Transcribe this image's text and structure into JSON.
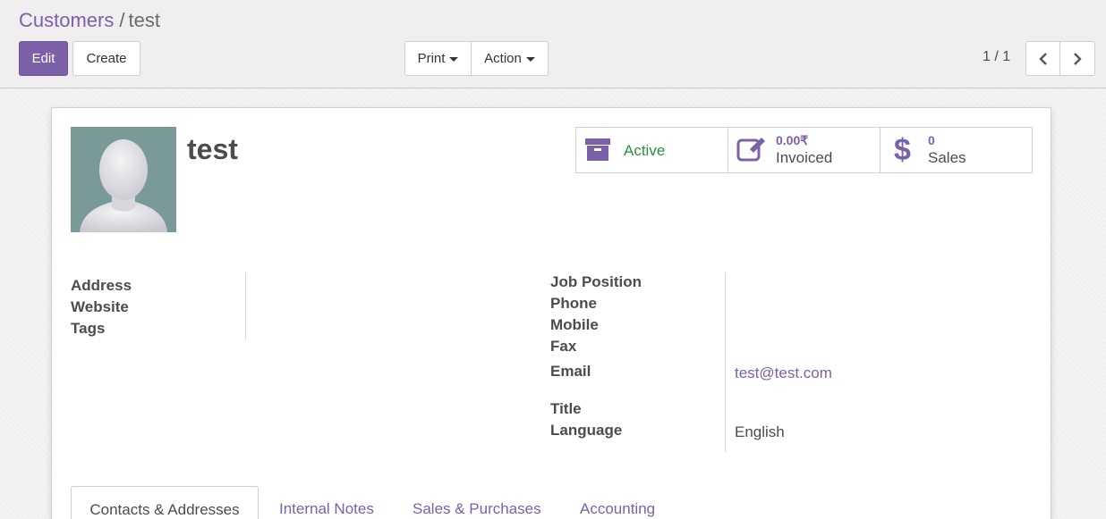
{
  "breadcrumb": {
    "parent": "Customers",
    "separator": "/",
    "current": "test"
  },
  "toolbar": {
    "edit_label": "Edit",
    "create_label": "Create",
    "print_label": "Print",
    "action_label": "Action"
  },
  "pager": {
    "value": "1 / 1"
  },
  "partner": {
    "name": "test"
  },
  "stats": {
    "active_label": "Active",
    "invoiced_value": "0.00₹",
    "invoiced_label": "Invoiced",
    "sales_value": "0",
    "sales_label": "Sales"
  },
  "fields_left": {
    "address_label": "Address",
    "website_label": "Website",
    "tags_label": "Tags"
  },
  "fields_right": {
    "job_position_label": "Job Position",
    "phone_label": "Phone",
    "mobile_label": "Mobile",
    "fax_label": "Fax",
    "email_label": "Email",
    "email_value": "test@test.com",
    "title_label": "Title",
    "language_label": "Language",
    "language_value": "English"
  },
  "tabs": [
    {
      "label": "Contacts & Addresses",
      "active": true
    },
    {
      "label": "Internal Notes",
      "active": false
    },
    {
      "label": "Sales & Purchases",
      "active": false
    },
    {
      "label": "Accounting",
      "active": false
    }
  ],
  "colors": {
    "brand": "#7c60a8",
    "active_green": "#2f8d3f",
    "avatar_bg": "#7a9999"
  },
  "icons": {
    "active": "archive-icon",
    "invoiced": "edit-icon",
    "sales": "dollar-icon",
    "pager_prev": "chevron-left-icon",
    "pager_next": "chevron-right-icon"
  }
}
